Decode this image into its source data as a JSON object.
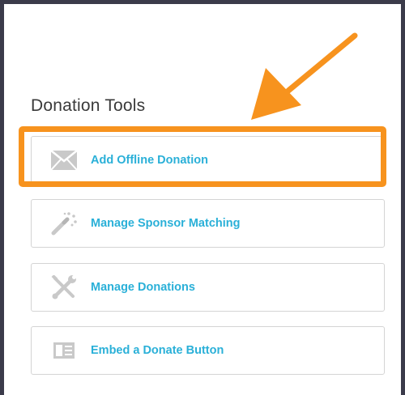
{
  "section": {
    "title": "Donation Tools"
  },
  "tools": [
    {
      "label": "Add Offline Donation",
      "icon": "envelope-icon"
    },
    {
      "label": "Manage Sponsor Matching",
      "icon": "magic-wand-icon"
    },
    {
      "label": "Manage Donations",
      "icon": "tools-icon"
    },
    {
      "label": "Embed a Donate Button",
      "icon": "embed-icon"
    }
  ],
  "colors": {
    "accent_link": "#2ab0d8",
    "highlight": "#f7931e",
    "icon_gray": "#c9c9c9",
    "frame": "#3b3b4a"
  }
}
